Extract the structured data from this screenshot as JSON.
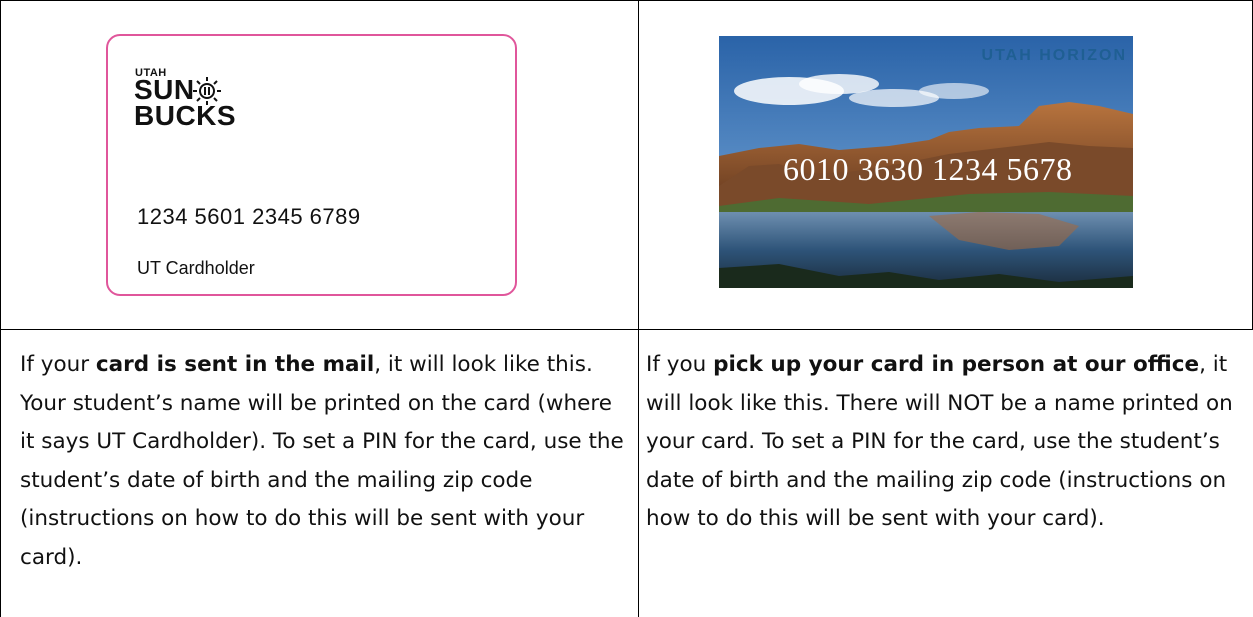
{
  "mail_card": {
    "brand_top": "UTAH",
    "brand_line1": "SUN",
    "brand_line2": "BUCKS",
    "card_number": "1234 5601 2345 6789",
    "cardholder": "UT Cardholder",
    "border_color": "#e0569b"
  },
  "office_card": {
    "brand": "UTAH HORIZON",
    "card_number": "6010 3630 1234 5678"
  },
  "left_text": {
    "a": "If your ",
    "b": "card is sent in the mail",
    "c": ", it will look like this. Your student’s name will be printed on the card (where it says UT Cardholder). To set a PIN for the card, use the student’s date of birth and the mailing zip code (instructions on how to do this will be sent with your card)."
  },
  "right_text": {
    "a": "If you ",
    "b": "pick up your card in person at our office",
    "c": ", it will look like this. There will NOT be a name printed on your card. To set a PIN for the card, use the student’s date of birth and the mailing zip code (instructions on how to do this will be sent with your card)."
  }
}
